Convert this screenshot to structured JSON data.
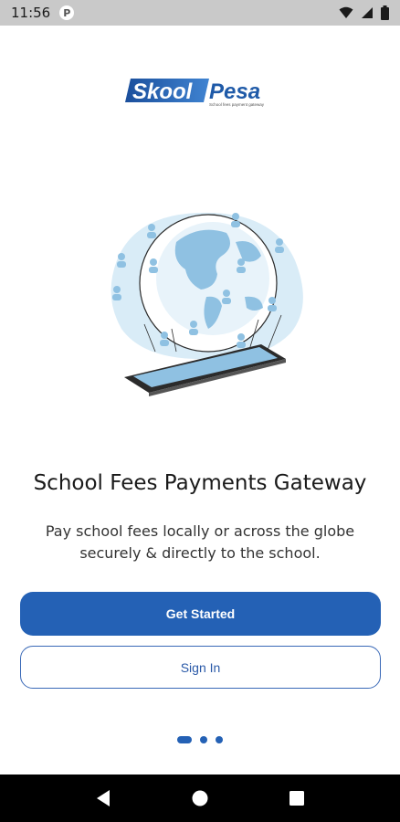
{
  "status_bar": {
    "time": "11:56",
    "app_icon": "P",
    "icons": [
      "wifi-icon",
      "signal-icon",
      "battery-icon"
    ]
  },
  "logo": {
    "brand_part1": "Skool",
    "brand_part2": "Pesa",
    "tagline": "School fees payment gateway",
    "colors": {
      "blue": "#1f5aa8",
      "gray": "#8a8f96"
    }
  },
  "headline": "School Fees Payments Gateway",
  "subtext": "Pay school fees locally or across the globe securely & directly to the school.",
  "buttons": {
    "get_started": "Get Started",
    "sign_in": "Sign In"
  },
  "pager": {
    "count": 3,
    "active_index": 0
  },
  "colors": {
    "primary": "#2461b5",
    "illustration": "#a9cfe7"
  },
  "nav_bar": {
    "buttons": [
      "back-icon",
      "home-icon",
      "recents-icon"
    ]
  }
}
